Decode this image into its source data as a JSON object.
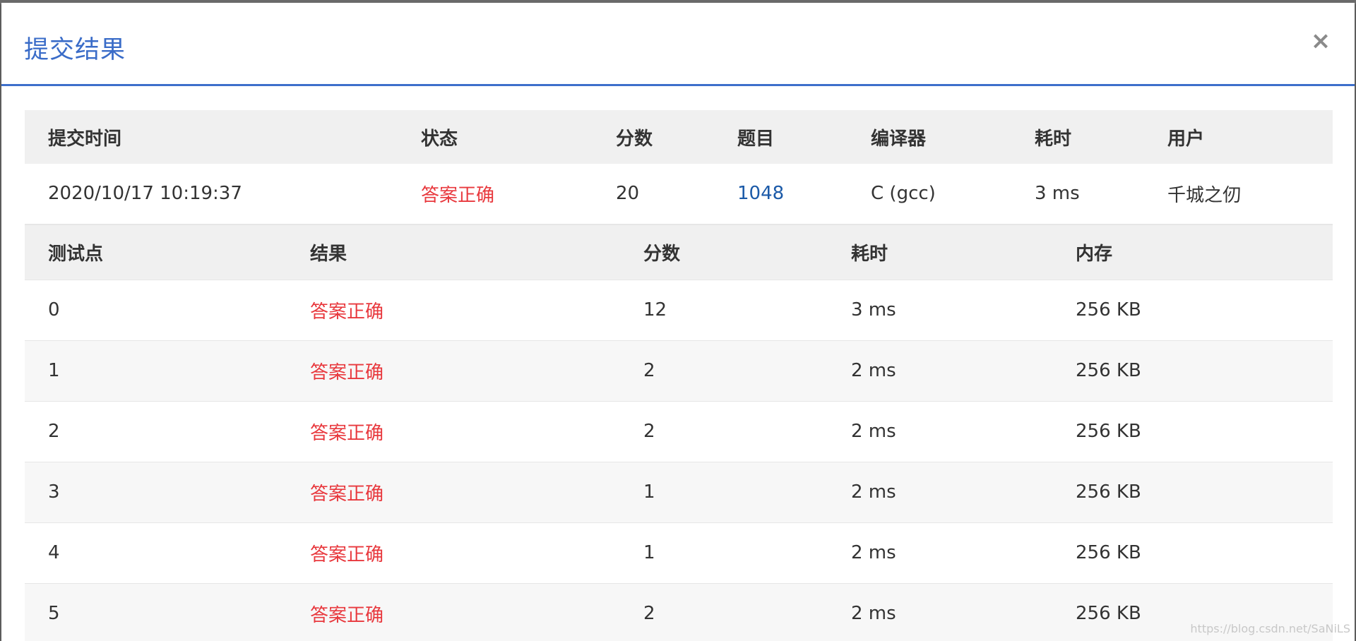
{
  "modal": {
    "title": "提交结果",
    "close_label": "×"
  },
  "summary": {
    "headers": [
      "提交时间",
      "状态",
      "分数",
      "题目",
      "编译器",
      "耗时",
      "用户"
    ],
    "row": {
      "time": "2020/10/17 10:19:37",
      "status": "答案正确",
      "score": "20",
      "problem": "1048",
      "compiler": "C (gcc)",
      "duration": "3 ms",
      "user": "千城之仞"
    }
  },
  "cases": {
    "headers": [
      "测试点",
      "结果",
      "分数",
      "耗时",
      "内存"
    ],
    "rows": [
      {
        "id": "0",
        "result": "答案正确",
        "score": "12",
        "time": "3 ms",
        "memory": "256 KB"
      },
      {
        "id": "1",
        "result": "答案正确",
        "score": "2",
        "time": "2 ms",
        "memory": "256 KB"
      },
      {
        "id": "2",
        "result": "答案正确",
        "score": "2",
        "time": "2 ms",
        "memory": "256 KB"
      },
      {
        "id": "3",
        "result": "答案正确",
        "score": "1",
        "time": "2 ms",
        "memory": "256 KB"
      },
      {
        "id": "4",
        "result": "答案正确",
        "score": "1",
        "time": "2 ms",
        "memory": "256 KB"
      },
      {
        "id": "5",
        "result": "答案正确",
        "score": "2",
        "time": "2 ms",
        "memory": "256 KB"
      }
    ]
  },
  "colors": {
    "accent": "#3a6cc8",
    "status_ok": "#e8383d",
    "link": "#1b5aa8"
  },
  "watermark": "https://blog.csdn.net/SaNiLS"
}
